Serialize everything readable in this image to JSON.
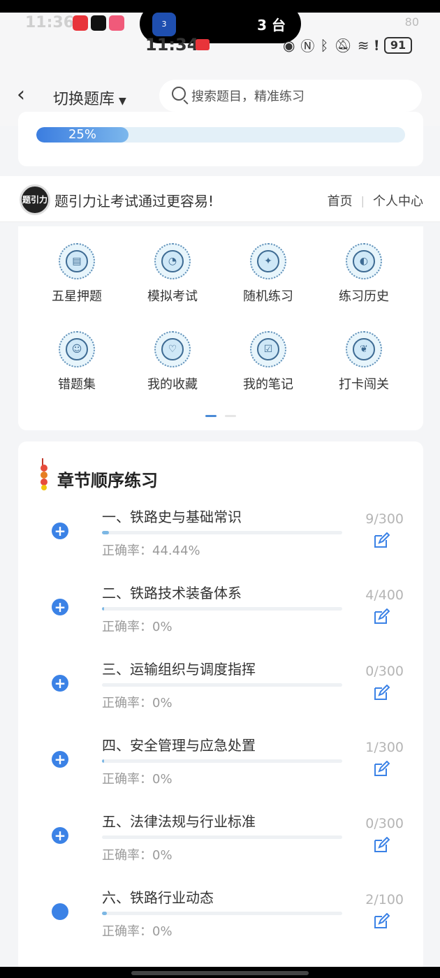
{
  "status_bar": {
    "ghost_time": "11:36",
    "time": "11:34",
    "island_icon_label": "3",
    "island_text": "3 台",
    "battery": "91",
    "ghost_battery": "80"
  },
  "header": {
    "switch_label": "切换题库",
    "search_placeholder": "搜索题目，精准练习"
  },
  "progress": {
    "label": "25%",
    "value": 0.25
  },
  "brand": {
    "logo_text": "题引力",
    "slogan": "题引力让考试通过更容易!",
    "nav": [
      "首页",
      "个人中心"
    ]
  },
  "features": [
    {
      "label": "五星押题",
      "icon": "id-card-icon"
    },
    {
      "label": "模拟考试",
      "icon": "gauge-icon"
    },
    {
      "label": "随机练习",
      "icon": "random-star-icon"
    },
    {
      "label": "练习历史",
      "icon": "history-globe-icon"
    },
    {
      "label": "错题集",
      "icon": "head-brain-icon"
    },
    {
      "label": "我的收藏",
      "icon": "heart-icon"
    },
    {
      "label": "我的笔记",
      "icon": "note-check-icon"
    },
    {
      "label": "打卡闯关",
      "icon": "sprout-icon"
    }
  ],
  "chapters": {
    "title": "章节顺序练习",
    "items": [
      {
        "name": "一、铁路史与基础常识",
        "accuracy": "正确率：44.44%",
        "count": "9/300",
        "progress": 0.03
      },
      {
        "name": "二、铁路技术装备体系",
        "accuracy": "正确率：0%",
        "count": "4/400",
        "progress": 0.01
      },
      {
        "name": "三、运输组织与调度指挥",
        "accuracy": "正确率：0%",
        "count": "0/300",
        "progress": 0
      },
      {
        "name": "四、安全管理与应急处置",
        "accuracy": "正确率：0%",
        "count": "1/300",
        "progress": 0.003
      },
      {
        "name": "五、法律法规与行业标准",
        "accuracy": "正确率：0%",
        "count": "0/300",
        "progress": 0
      },
      {
        "name": "六、铁路行业动态",
        "accuracy": "正确率：0%",
        "count": "2/100",
        "progress": 0.02
      }
    ]
  },
  "colors": {
    "accent": "#3b82e6",
    "progress_fill": "#3b7de0",
    "track": "#e3f0f8"
  }
}
